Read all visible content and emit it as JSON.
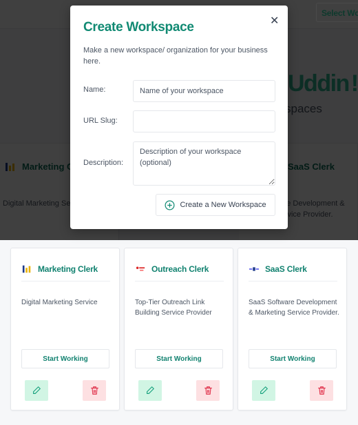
{
  "header": {
    "select_workspace_label": "Select Wo"
  },
  "hero": {
    "title": "Uddin !",
    "subtitle": "spaces"
  },
  "cards": [
    {
      "title": "Marketing Clerk",
      "description": "Digital Marketing Service",
      "start_label": "Start Working",
      "logo": "marketing-clerk-logo"
    },
    {
      "title": "Outreach Clerk",
      "description": "Top-Tier Outreach Link Building Service Provider",
      "start_label": "Start Working",
      "logo": "outreach-clerk-logo"
    },
    {
      "title": "SaaS Clerk",
      "description": "SaaS Software Development & Marketing Service Provider.",
      "start_label": "Start Working",
      "logo": "saas-clerk-logo"
    }
  ],
  "modal": {
    "title": "Create Workspace",
    "subtitle": "Make a new workspace/ organization for your business here.",
    "close_icon": "close-icon",
    "name_label": "Name:",
    "name_placeholder": "Name of your workspace",
    "name_value": "",
    "slug_label": "URL Slug:",
    "slug_value": "",
    "description_label": "Description:",
    "description_placeholder": "Description of your workspace (optional)",
    "description_value": "",
    "create_label": "Create a New Workspace"
  },
  "colors": {
    "accent": "#118a73",
    "edit_bg": "#d1f5e4",
    "delete_bg": "#fde0e2",
    "delete_icon": "#e0304a"
  }
}
